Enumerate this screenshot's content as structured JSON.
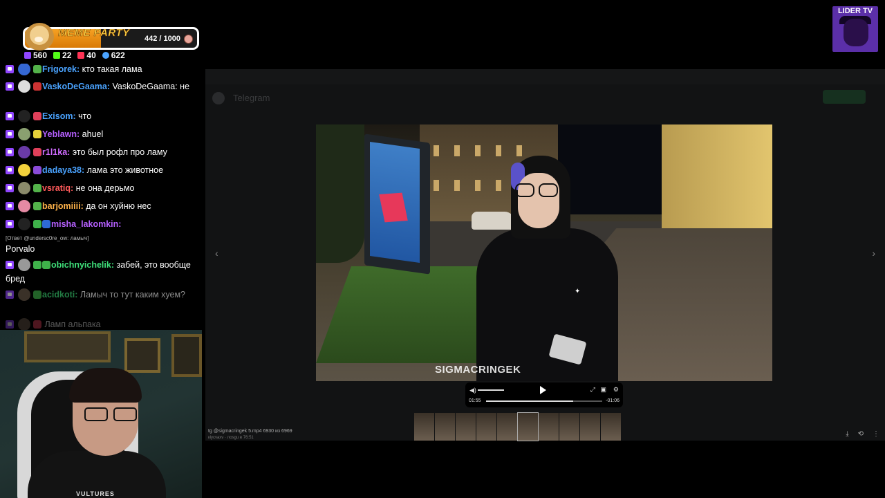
{
  "meme_party": {
    "title": "MEME PARTY",
    "count": "442 / 1000",
    "progress": 0.442
  },
  "stats": [
    {
      "icon": "twitch-icon",
      "value": "560",
      "color": "#9146ff"
    },
    {
      "icon": "kick-icon",
      "value": "22",
      "color": "#53fc18"
    },
    {
      "icon": "vkplay-icon",
      "value": "40",
      "color": "#ff3355"
    },
    {
      "icon": "viewers-icon",
      "value": "622",
      "color": "#4aa3ff"
    }
  ],
  "chat": {
    "messages": [
      {
        "user": "Frigorek:",
        "text": " кто такая лама",
        "color": "#4aa3ff"
      },
      {
        "user": "VaskoDeGaama:",
        "text": " VaskoDeGaama: не",
        "color": "#4aa3ff"
      },
      {
        "user": "Exisom:",
        "text": " что",
        "color": "#4aa3ff"
      },
      {
        "user": "Yeblawn:",
        "text": " ahuel",
        "color": "#b660ff"
      },
      {
        "user": "r1l1ka:",
        "text": " это был рофл про ламу",
        "color": "#d06cff"
      },
      {
        "user": "dadaya38:",
        "text": " лама это животное",
        "color": "#4aa3ff"
      },
      {
        "user": "vsratiq:",
        "text": " не она дерьмо",
        "color": "#ff5a5a"
      },
      {
        "user": "barjomiiii:",
        "text": " да он хуйню нес",
        "color": "#ffb34a"
      },
      {
        "user": "misha_lakomkin:",
        "text": "",
        "color": "#b660ff"
      },
      {
        "user": "",
        "text": "Porvalo",
        "color": "#ffffff"
      },
      {
        "user": "obichnyichelik:",
        "text": " забей, это вообще бред",
        "color": "#3fe07a"
      },
      {
        "user": "acidkoti:",
        "text": " Ламыч то тут каким хуем?",
        "color": "#3fe07a"
      },
      {
        "user": "",
        "text": " Ламп альпака",
        "color": "#2233cc"
      }
    ],
    "reply_line": "[Ответ @undersc0re_ow: ламыч]"
  },
  "cam": {
    "shirt_text": "VULTURES"
  },
  "viewer": {
    "app_name": "Telegram",
    "watermark": "SIGMACRINGEK",
    "time_current": "01:55",
    "time_remaining": "-01:06",
    "progress": 0.75,
    "caption": "tg @sigmacringek 5.mp4 6930 из 6969",
    "caption_sub": "кlycvaxv · лоsgu в 76:51",
    "thumbnails": 10
  },
  "logo": {
    "text": "LIDER TV"
  }
}
